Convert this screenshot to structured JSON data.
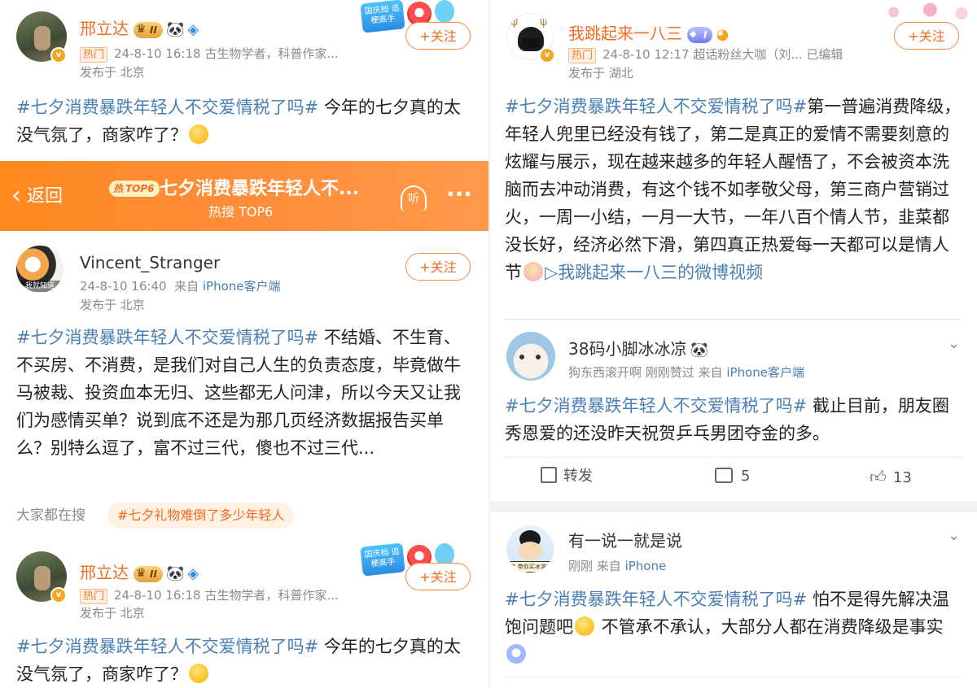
{
  "post_top_left": {
    "author": "邢立达",
    "level": "II",
    "hot_label": "热门",
    "meta": "24-8-10 16:18  古生物学者，科普作家...",
    "location": "发布于 北京",
    "follow_label": "+关注",
    "tag": "#七夕消费暴跌年轻人不交爱情税了吗#",
    "text": " 今年的七夕真的太没气氛了，商家咋了？",
    "badge_text": "国庆档 追梗高手"
  },
  "trending_bar": {
    "back_label": "返回",
    "title": "七夕消费暴跌年轻人不...",
    "subtitle": "热搜 TOP6",
    "top_badge": "TOP6",
    "listen_label": "听",
    "more_label": "···"
  },
  "post_vincent": {
    "author": "Vincent_Stranger",
    "avatar_caption": "我就知道",
    "time": "24-8-10 16:40",
    "source_prefix": "来自",
    "source": "iPhone客户端",
    "location": "发布于 北京",
    "follow_label": "+关注",
    "tag": "#七夕消费暴跌年轻人不交爱情税了吗#",
    "text": " 不结婚、不生育、不买房、不消费，是我们对自己人生的负责态度，毕竟做牛马被裁、投资血本无归、这些都无人问津，所以今天又让我们为感情买单？说到底不还是为那几页经济数据报告买单么？别特么逗了，富不过三代，傻也不过三代..."
  },
  "search_row": {
    "label": "大家都在搜",
    "chip": "#七夕礼物难倒了多少年轻人"
  },
  "post_bottom_left": {
    "author": "邢立达",
    "level": "II",
    "hot_label": "热门",
    "meta": "24-8-10 16:18  古生物学者，科普作家...",
    "location": "发布于 北京",
    "follow_label": "+关注",
    "tag": "#七夕消费暴跌年轻人不交爱情税了吗#",
    "text": " 今年的七夕真的太没气氛了，商家咋了？",
    "badge_text": "国庆档 追梗高手"
  },
  "post_right_top": {
    "author": "我跳起来一八三",
    "level": "I",
    "hot_label": "热门",
    "meta": "24-8-10 12:17  超话粉丝大咖（刘...  已编辑",
    "location": "发布于 湖北",
    "follow_label": "+关注",
    "tag": "#七夕消费暴跌年轻人不交爱情税了吗#",
    "text": "第一普遍消费降级，年轻人兜里已经没有钱了，第二是真正的爱情不需要刻意的炫耀与展示，现在越来越多的年轻人醒悟了，不会被资本洗脑而去冲动消费，有这个钱不如孝敬父母，第三商户营销过火，一周一小结，一月一大节，一年八百个情人节，韭菜都没长好，经济必然下滑，第四真正热爱每一天都可以是情人节",
    "video_link": "我跳起来一八三的微博视频"
  },
  "comment_1": {
    "author": "38码小脚冰冰凉",
    "meta_prefix": "狗东西滚开啊  刚刚赞过  来自",
    "source": "iPhone客户端",
    "tag": "#七夕消费暴跌年轻人不交爱情税了吗#",
    "text": " 截止目前，朋友圈秀恩爱的还没昨天祝贺乒乓男团夺金的多。",
    "repost_label": "转发",
    "comments_count": "5",
    "likes_count": "13"
  },
  "comment_2": {
    "author": "有一说一就是说",
    "avatar_caption": "走 带你买冰淇淋",
    "meta_prefix": "刚刚  来自",
    "source": "iPhone",
    "tag": "#七夕消费暴跌年轻人不交爱情税了吗#",
    "text_a": " 怕不是得先解决温饱问题吧",
    "text_b": " 不管承不承认，大部分人都在消费降级是事实"
  },
  "colors": {
    "accent": "#f36c21",
    "link": "#4a7fb5",
    "bar": "#ff8a1f"
  }
}
